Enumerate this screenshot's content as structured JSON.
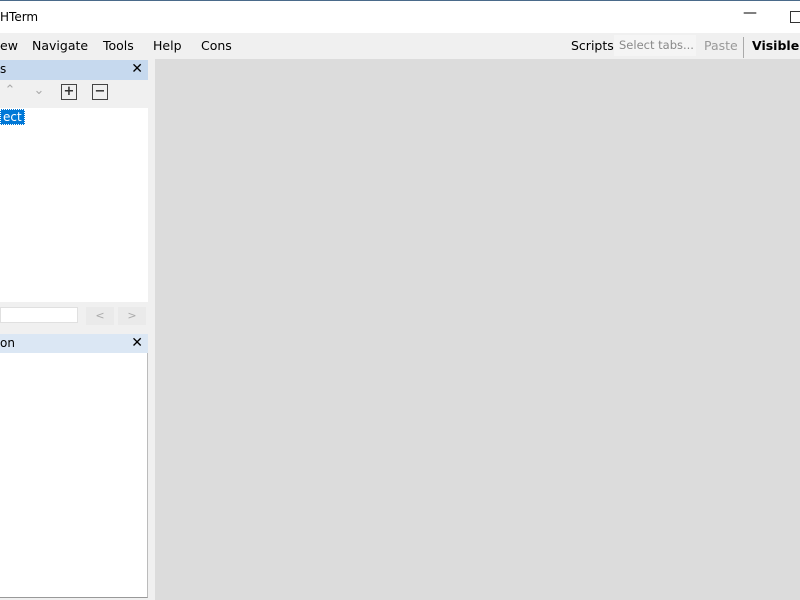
{
  "window": {
    "title": "HTerm",
    "minimize_icon": "minimize-icon",
    "maximize_icon": "maximize-icon"
  },
  "menu": {
    "items": [
      "ew",
      "Navigate",
      "Tools",
      "Help",
      "Cons"
    ]
  },
  "toolbar": {
    "scripts": "Scripts",
    "select_tabs_placeholder": "Select tabs...",
    "paste": "Paste",
    "visible": "Visible"
  },
  "panel1": {
    "title": "s",
    "close": "✕",
    "up": "⌃",
    "down": "⌄",
    "expand": "+",
    "collapse": "−",
    "selected_item": "ect",
    "prev": "<",
    "next": ">"
  },
  "panel2": {
    "title": "on",
    "close": "✕"
  },
  "colors": {
    "panel_header": "#c6d9ee",
    "panel_header_inactive": "#dbe7f4",
    "selection": "#0078d7",
    "main_bg": "#dcdcdc"
  }
}
